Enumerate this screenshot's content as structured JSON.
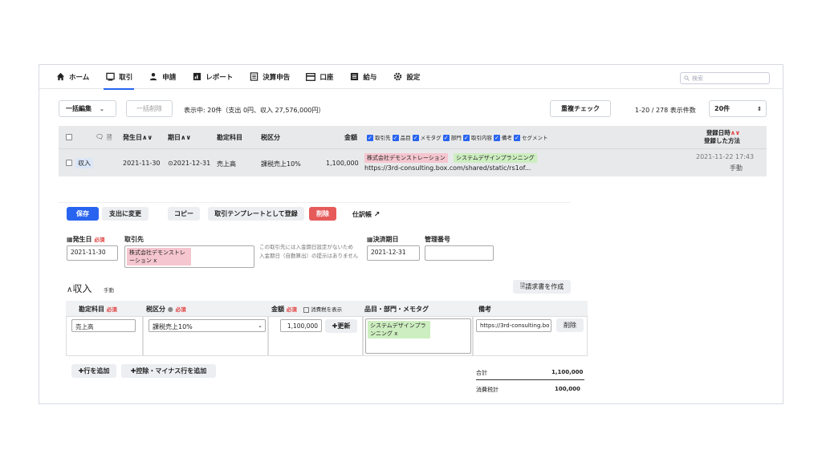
{
  "nav": {
    "items": [
      {
        "label": "ホーム",
        "icon": "home-icon"
      },
      {
        "label": "取引",
        "icon": "deal-icon",
        "active": true
      },
      {
        "label": "申請",
        "icon": "user-check-icon"
      },
      {
        "label": "レポート",
        "icon": "report-icon"
      },
      {
        "label": "決算申告",
        "icon": "document-icon"
      },
      {
        "label": "口座",
        "icon": "card-icon"
      },
      {
        "label": "給与",
        "icon": "list-icon"
      },
      {
        "label": "設定",
        "icon": "gear-icon"
      }
    ],
    "search_placeholder": "検索"
  },
  "toolbar": {
    "bulk_edit": "一括編集",
    "bulk_delete": "一括削除",
    "summary": "表示中: 20件（支出 0円、収入 27,576,000円）",
    "dup_check": "重複チェック",
    "pager": "1-20 / 278",
    "per_page_label": "表示件数",
    "per_page_value": "20件"
  },
  "table": {
    "headers": {
      "date": "発生日",
      "due": "期日",
      "account": "勘定科目",
      "tax": "税区分",
      "amount": "金額",
      "registered_at": "登録日時",
      "method": "登録した方法"
    },
    "toggles": [
      "取引先",
      "品目",
      "メモタグ",
      "部門",
      "取引内容",
      "備考",
      "セグメント"
    ],
    "row": {
      "type": "収入",
      "date": "2021-11-30",
      "due": "2021-12-31",
      "account": "売上高",
      "tax": "課税売上10%",
      "amount": "1,100,000",
      "partner": "株式会社デモンストレーション",
      "item": "システムデザインプランニング",
      "url": "https://3rd-consulting.box.com/shared/static/rs1of...",
      "registered_at": "2021-11-22 17:43",
      "method": "手動"
    }
  },
  "form": {
    "save": "保存",
    "change_to_expense": "支出に変更",
    "copy": "コピー",
    "register_template": "取引テンプレートとして登録",
    "delete": "削除",
    "journal": "仕訳帳",
    "date_label": "発生日",
    "required": "必須",
    "partner_label": "取引先",
    "partner_note_1": "この取引先には入金期日設定がないため",
    "partner_note_2": "入金期日（自動算出）の提示はありません",
    "due_label": "決済期日",
    "mgmt_label": "管理番号",
    "date_value": "2021-11-30",
    "partner_value": "株式会社デモンストレーション x",
    "due_value": "2021-12-31",
    "mgmt_value": "",
    "section_title": "収入",
    "section_sub": "手動",
    "invoice_button": "請求書を作成",
    "col_account": "勘定科目",
    "col_tax": "税区分",
    "col_amount": "金額",
    "col_tax_display": "消費税を表示",
    "col_item": "品目・部門・メモタグ",
    "col_note": "備考",
    "line_account": "売上高",
    "line_tax": "課税売上10%",
    "line_amount": "1,100,000",
    "update": "更新",
    "line_item": "システムデザインプランニング x",
    "line_note": "https://3rd-consulting.bo",
    "line_delete": "削除",
    "add_row": "行を追加",
    "add_minus_row": "控除・マイナス行を追加",
    "total_label": "合計",
    "total_value": "1,100,000",
    "tax_total_label": "消費税計",
    "tax_total_value": "100,000"
  }
}
